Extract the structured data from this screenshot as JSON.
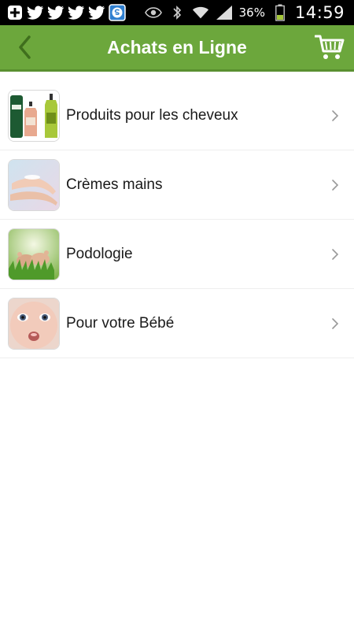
{
  "status_bar": {
    "battery_percent": "36%",
    "time": "14:59",
    "left_icons": [
      "plus-icon",
      "twitter-icon",
      "twitter-icon",
      "twitter-icon",
      "twitter-icon",
      "skype-icon"
    ],
    "right_icons": [
      "eye-icon",
      "bluetooth-icon",
      "wifi-icon",
      "signal-icon",
      "battery-icon"
    ]
  },
  "header": {
    "title": "Achats en Ligne",
    "back_icon": "chevron-left-icon",
    "cart_icon": "cart-icon",
    "color": "#6ca73c"
  },
  "list": {
    "items": [
      {
        "label": "Produits pour les cheveux",
        "thumbnail": "hair-products-image"
      },
      {
        "label": "Crèmes mains",
        "thumbnail": "hand-cream-image"
      },
      {
        "label": "Podologie",
        "thumbnail": "feet-image"
      },
      {
        "label": "Pour votre Bébé",
        "thumbnail": "baby-image"
      }
    ]
  }
}
